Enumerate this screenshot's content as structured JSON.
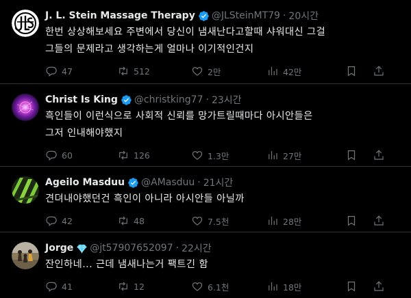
{
  "tweets": [
    {
      "name": "J. L. Stein Massage Therapy",
      "verified": "blue",
      "handle": "@JLSteinMT79",
      "dot": "·",
      "time": "20시간",
      "text": "한번 상상해보세요 주변에서 당신이 냄새난다고할때 샤워대신 그걸\n그들의 문제라고 생각하는게 얼마나 이기적인건지",
      "replies": "47",
      "retweets": "512",
      "likes": "2만",
      "views": "42만",
      "avatar_icon": "jls-logo-icon"
    },
    {
      "name": "Christ Is King",
      "verified": "blue",
      "handle": "@christking77",
      "dot": "·",
      "time": "23시간",
      "text": "흑인들이 이런식으로 사회적 신뢰를 망가트릴때마다 아시안들은\n그저 인내해야했지",
      "replies": "60",
      "retweets": "126",
      "likes": "1.3만",
      "views": "27만",
      "avatar_icon": "purple-orb-icon"
    },
    {
      "name": "Ageilo Masduu",
      "verified": "blue",
      "handle": "@AMasduu",
      "dot": "·",
      "time": "21시간",
      "text": "견뎌내야했던건 흑인이 아니라 아시안들 아닐까",
      "replies": "42",
      "retweets": "48",
      "likes": "7.5천",
      "views": "28만",
      "avatar_icon": "green-stripes-icon"
    },
    {
      "name": "Jorge",
      "verified": "diamond",
      "handle": "@jt57907652097",
      "dot": "·",
      "time": "22시간",
      "text": "잔인하네... 근데 냄새나는거 팩트긴 함",
      "replies": "41",
      "retweets": "12",
      "likes": "6.1천",
      "views": "18만",
      "avatar_icon": "photo-avatar-icon"
    }
  ],
  "colors": {
    "background": "#000000",
    "text": "#e7e9ea",
    "muted": "#71767b",
    "divider": "#2f3336",
    "verified_blue": "#1d9bf0",
    "diamond": "#5ad1f6"
  }
}
